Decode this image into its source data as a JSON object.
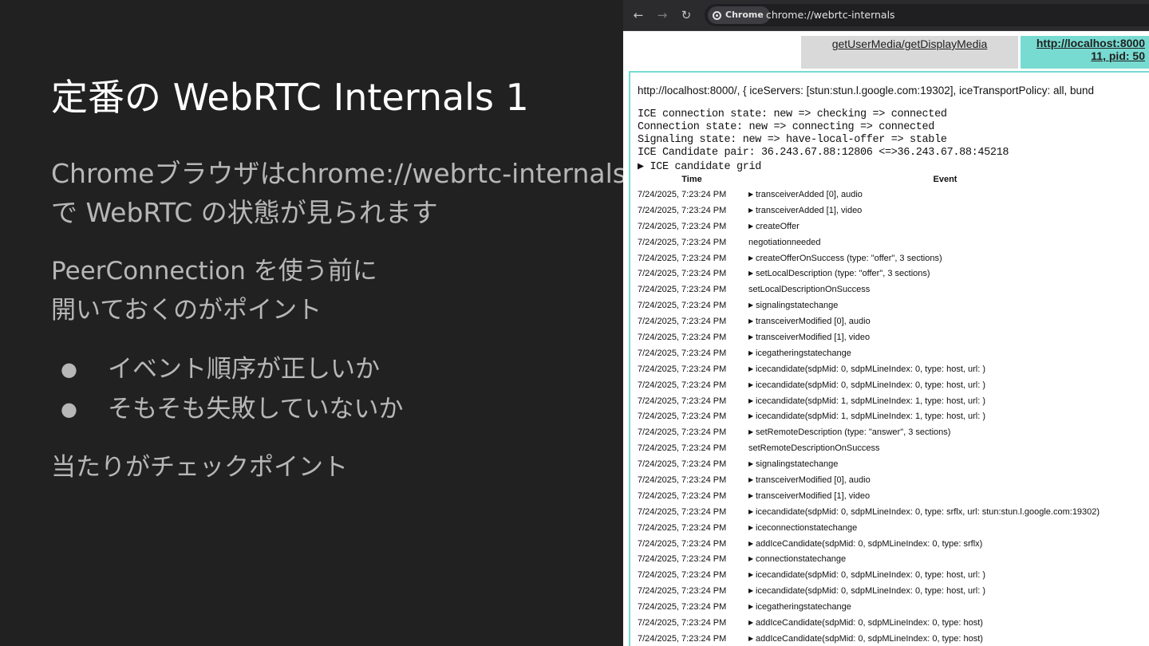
{
  "slide": {
    "title": "定番の WebRTC Internals 1",
    "para1_line1": "Chromeブラウザはchrome://webrtc-internals",
    "para1_line2": "で WebRTC の状態が見られます",
    "para2_line1": "PeerConnection を使う前に",
    "para2_line2": "開いておくのがポイント",
    "bullets": [
      "イベント順序が正しいか",
      "そもそも失敗していないか"
    ],
    "bullet_glyph": "●",
    "para3": "当たりがチェックポイント"
  },
  "browser": {
    "chip_label": "Chrome",
    "url": "chrome://webrtc-internals",
    "nav": {
      "back": "←",
      "forward": "→",
      "reload": "↻"
    },
    "tabs": {
      "gum": "getUserMedia/getDisplayMedia",
      "pc_line1": "http://localhost:8000",
      "pc_line2": "11, pid: 50"
    },
    "pc_url": "http://localhost:8000/, { iceServers: [stun:stun.l.google.com:19302], iceTransportPolicy: all, bund",
    "states": [
      "ICE connection state: new => checking => connected",
      "Connection state: new => connecting => connected",
      "Signaling state: new => have-local-offer => stable",
      "ICE Candidate pair: 36.243.67.88:12806 <=>36.243.67.88:45218"
    ],
    "grid_toggle": "▶ ICE candidate grid",
    "table_headers": {
      "time": "Time",
      "event": "Event"
    },
    "events": [
      {
        "time": "7/24/2025, 7:23:24 PM",
        "expand": true,
        "event": "transceiverAdded [0], audio"
      },
      {
        "time": "7/24/2025, 7:23:24 PM",
        "expand": true,
        "event": "transceiverAdded [1], video"
      },
      {
        "time": "7/24/2025, 7:23:24 PM",
        "expand": true,
        "event": "createOffer"
      },
      {
        "time": "7/24/2025, 7:23:24 PM",
        "expand": false,
        "event": "negotiationneeded"
      },
      {
        "time": "7/24/2025, 7:23:24 PM",
        "expand": true,
        "event": "createOfferOnSuccess (type: \"offer\", 3 sections)"
      },
      {
        "time": "7/24/2025, 7:23:24 PM",
        "expand": true,
        "event": "setLocalDescription (type: \"offer\", 3 sections)"
      },
      {
        "time": "7/24/2025, 7:23:24 PM",
        "expand": false,
        "event": "setLocalDescriptionOnSuccess"
      },
      {
        "time": "7/24/2025, 7:23:24 PM",
        "expand": true,
        "event": "signalingstatechange"
      },
      {
        "time": "7/24/2025, 7:23:24 PM",
        "expand": true,
        "event": "transceiverModified [0], audio"
      },
      {
        "time": "7/24/2025, 7:23:24 PM",
        "expand": true,
        "event": "transceiverModified [1], video"
      },
      {
        "time": "7/24/2025, 7:23:24 PM",
        "expand": true,
        "event": "icegatheringstatechange"
      },
      {
        "time": "7/24/2025, 7:23:24 PM",
        "expand": true,
        "event": "icecandidate(sdpMid: 0, sdpMLineIndex: 0, type: host, url: )"
      },
      {
        "time": "7/24/2025, 7:23:24 PM",
        "expand": true,
        "event": "icecandidate(sdpMid: 0, sdpMLineIndex: 0, type: host, url: )"
      },
      {
        "time": "7/24/2025, 7:23:24 PM",
        "expand": true,
        "event": "icecandidate(sdpMid: 1, sdpMLineIndex: 1, type: host, url: )"
      },
      {
        "time": "7/24/2025, 7:23:24 PM",
        "expand": true,
        "event": "icecandidate(sdpMid: 1, sdpMLineIndex: 1, type: host, url: )"
      },
      {
        "time": "7/24/2025, 7:23:24 PM",
        "expand": true,
        "event": "setRemoteDescription (type: \"answer\", 3 sections)"
      },
      {
        "time": "7/24/2025, 7:23:24 PM",
        "expand": false,
        "event": "setRemoteDescriptionOnSuccess"
      },
      {
        "time": "7/24/2025, 7:23:24 PM",
        "expand": true,
        "event": "signalingstatechange"
      },
      {
        "time": "7/24/2025, 7:23:24 PM",
        "expand": true,
        "event": "transceiverModified [0], audio"
      },
      {
        "time": "7/24/2025, 7:23:24 PM",
        "expand": true,
        "event": "transceiverModified [1], video"
      },
      {
        "time": "7/24/2025, 7:23:24 PM",
        "expand": true,
        "event": "icecandidate(sdpMid: 0, sdpMLineIndex: 0, type: srflx, url: stun:stun.l.google.com:19302)"
      },
      {
        "time": "7/24/2025, 7:23:24 PM",
        "expand": true,
        "event": "iceconnectionstatechange"
      },
      {
        "time": "7/24/2025, 7:23:24 PM",
        "expand": true,
        "event": "addIceCandidate(sdpMid: 0, sdpMLineIndex: 0, type: srflx)"
      },
      {
        "time": "7/24/2025, 7:23:24 PM",
        "expand": true,
        "event": "connectionstatechange"
      },
      {
        "time": "7/24/2025, 7:23:24 PM",
        "expand": true,
        "event": "icecandidate(sdpMid: 0, sdpMLineIndex: 0, type: host, url: )"
      },
      {
        "time": "7/24/2025, 7:23:24 PM",
        "expand": true,
        "event": "icecandidate(sdpMid: 0, sdpMLineIndex: 0, type: host, url: )"
      },
      {
        "time": "7/24/2025, 7:23:24 PM",
        "expand": true,
        "event": "icegatheringstatechange"
      },
      {
        "time": "7/24/2025, 7:23:24 PM",
        "expand": true,
        "event": "addIceCandidate(sdpMid: 0, sdpMLineIndex: 0, type: host)"
      },
      {
        "time": "7/24/2025, 7:23:24 PM",
        "expand": true,
        "event": "addIceCandidate(sdpMid: 0, sdpMLineIndex: 0, type: host)"
      }
    ],
    "expand_glyph": "▶"
  },
  "colors": {
    "slide_bg": "#212121",
    "tab_active": "#77dbd1",
    "tab_inactive": "#d9d9d9"
  }
}
